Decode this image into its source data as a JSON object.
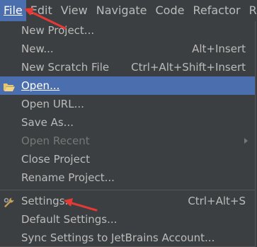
{
  "menubar": {
    "items": [
      {
        "label": "File"
      },
      {
        "label": "Edit"
      },
      {
        "label": "View"
      },
      {
        "label": "Navigate"
      },
      {
        "label": "Code"
      },
      {
        "label": "Refactor"
      },
      {
        "label": "R"
      }
    ]
  },
  "menu": {
    "new_project": "New Project...",
    "new": "New...",
    "new_shortcut": "Alt+Insert",
    "new_scratch": "New Scratch File",
    "new_scratch_shortcut": "Ctrl+Alt+Shift+Insert",
    "open": "Open...",
    "open_url": "Open URL...",
    "save_as": "Save As...",
    "open_recent": "Open Recent",
    "close_project": "Close Project",
    "rename_project": "Rename Project...",
    "settings": "Settings...",
    "settings_shortcut": "Ctrl+Alt+S",
    "default_settings": "Default Settings...",
    "sync_settings": "Sync Settings to JetBrains Account..."
  },
  "colors": {
    "menu_bg": "#3c3f41",
    "highlight": "#4b6eaf",
    "text": "#bbbbbb",
    "disabled_text": "#777777",
    "annotation_arrow": "#e53935"
  },
  "icons": {
    "open": "folder-open-icon",
    "settings": "wrench-icon"
  }
}
